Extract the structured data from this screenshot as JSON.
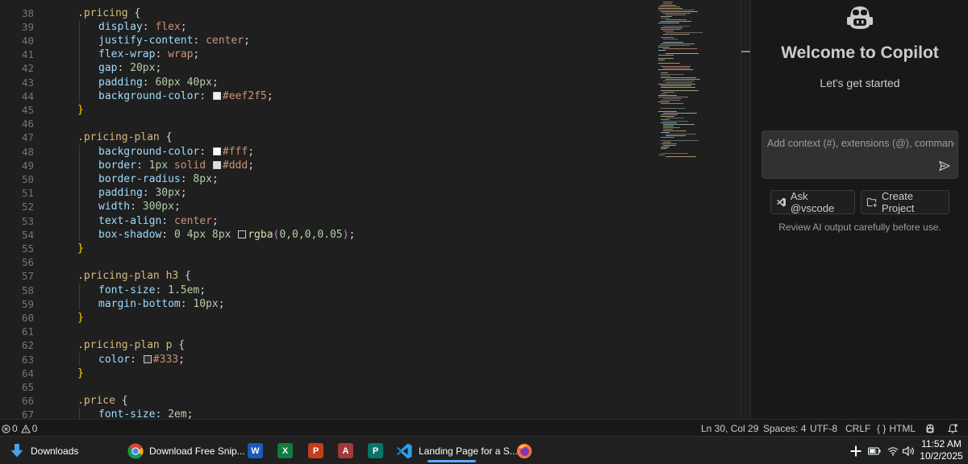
{
  "editor": {
    "line_numbers": [
      "38",
      "39",
      "40",
      "41",
      "42",
      "43",
      "44",
      "45",
      "46",
      "47",
      "48",
      "49",
      "50",
      "51",
      "52",
      "53",
      "54",
      "55",
      "56",
      "57",
      "58",
      "59",
      "60",
      "61",
      "62",
      "63",
      "64",
      "65",
      "66",
      "67"
    ],
    "lines": [
      [
        {
          "t": ".pricing",
          "c": "#d7ba7d"
        },
        {
          "t": " {",
          "c": "#d4d4d4"
        }
      ],
      [
        {
          "t": "display",
          "c": "#9cdcfe"
        },
        {
          "t": ": ",
          "c": "#d4d4d4"
        },
        {
          "t": "flex",
          "c": "#ce9178"
        },
        {
          "t": ";",
          "c": "#d4d4d4"
        }
      ],
      [
        {
          "t": "justify-content",
          "c": "#9cdcfe"
        },
        {
          "t": ": ",
          "c": "#d4d4d4"
        },
        {
          "t": "center",
          "c": "#ce9178"
        },
        {
          "t": ";",
          "c": "#d4d4d4"
        }
      ],
      [
        {
          "t": "flex-wrap",
          "c": "#9cdcfe"
        },
        {
          "t": ": ",
          "c": "#d4d4d4"
        },
        {
          "t": "wrap",
          "c": "#ce9178"
        },
        {
          "t": ";",
          "c": "#d4d4d4"
        }
      ],
      [
        {
          "t": "gap",
          "c": "#9cdcfe"
        },
        {
          "t": ": ",
          "c": "#d4d4d4"
        },
        {
          "t": "20px",
          "c": "#b5cea8"
        },
        {
          "t": ";",
          "c": "#d4d4d4"
        }
      ],
      [
        {
          "t": "padding",
          "c": "#9cdcfe"
        },
        {
          "t": ": ",
          "c": "#d4d4d4"
        },
        {
          "t": "60px 40px",
          "c": "#b5cea8"
        },
        {
          "t": ";",
          "c": "#d4d4d4"
        }
      ],
      [
        {
          "t": "background-color",
          "c": "#9cdcfe"
        },
        {
          "t": ": ",
          "c": "#d4d4d4"
        },
        {
          "sw": "#eef2f5"
        },
        {
          "t": "#eef2f5",
          "c": "#ce9178"
        },
        {
          "t": ";",
          "c": "#d4d4d4"
        }
      ],
      [
        {
          "t": "}",
          "c": "#ffd700"
        }
      ],
      [],
      [
        {
          "t": ".pricing-plan",
          "c": "#d7ba7d"
        },
        {
          "t": " {",
          "c": "#d4d4d4"
        }
      ],
      [
        {
          "t": "background-color",
          "c": "#9cdcfe"
        },
        {
          "t": ": ",
          "c": "#d4d4d4"
        },
        {
          "sw": "#ffffff"
        },
        {
          "t": "#fff",
          "c": "#ce9178"
        },
        {
          "t": ";",
          "c": "#d4d4d4"
        }
      ],
      [
        {
          "t": "border",
          "c": "#9cdcfe"
        },
        {
          "t": ": ",
          "c": "#d4d4d4"
        },
        {
          "t": "1px",
          "c": "#b5cea8"
        },
        {
          "t": " solid ",
          "c": "#ce9178"
        },
        {
          "sw": "#dddddd"
        },
        {
          "t": "#ddd",
          "c": "#ce9178"
        },
        {
          "t": ";",
          "c": "#d4d4d4"
        }
      ],
      [
        {
          "t": "border-radius",
          "c": "#9cdcfe"
        },
        {
          "t": ": ",
          "c": "#d4d4d4"
        },
        {
          "t": "8px",
          "c": "#b5cea8"
        },
        {
          "t": ";",
          "c": "#d4d4d4"
        }
      ],
      [
        {
          "t": "padding",
          "c": "#9cdcfe"
        },
        {
          "t": ": ",
          "c": "#d4d4d4"
        },
        {
          "t": "30px",
          "c": "#b5cea8"
        },
        {
          "t": ";",
          "c": "#d4d4d4"
        }
      ],
      [
        {
          "t": "width",
          "c": "#9cdcfe"
        },
        {
          "t": ": ",
          "c": "#d4d4d4"
        },
        {
          "t": "300px",
          "c": "#b5cea8"
        },
        {
          "t": ";",
          "c": "#d4d4d4"
        }
      ],
      [
        {
          "t": "text-align",
          "c": "#9cdcfe"
        },
        {
          "t": ": ",
          "c": "#d4d4d4"
        },
        {
          "t": "center",
          "c": "#ce9178"
        },
        {
          "t": ";",
          "c": "#d4d4d4"
        }
      ],
      [
        {
          "t": "box-shadow",
          "c": "#9cdcfe"
        },
        {
          "t": ": ",
          "c": "#d4d4d4"
        },
        {
          "t": "0 4px 8px ",
          "c": "#b5cea8"
        },
        {
          "sw": "transparent"
        },
        {
          "t": "rgba",
          "c": "#dcdcaa"
        },
        {
          "t": "(",
          "c": "#da70d6"
        },
        {
          "t": "0,0,0,0.05",
          "c": "#b5cea8"
        },
        {
          "t": ")",
          "c": "#da70d6"
        },
        {
          "t": ";",
          "c": "#d4d4d4"
        }
      ],
      [
        {
          "t": "}",
          "c": "#ffd700"
        }
      ],
      [],
      [
        {
          "t": ".pricing-plan h3",
          "c": "#d7ba7d"
        },
        {
          "t": " {",
          "c": "#d4d4d4"
        }
      ],
      [
        {
          "t": "font-size",
          "c": "#9cdcfe"
        },
        {
          "t": ": ",
          "c": "#d4d4d4"
        },
        {
          "t": "1.5em",
          "c": "#b5cea8"
        },
        {
          "t": ";",
          "c": "#d4d4d4"
        }
      ],
      [
        {
          "t": "margin-bottom",
          "c": "#9cdcfe"
        },
        {
          "t": ": ",
          "c": "#d4d4d4"
        },
        {
          "t": "10px",
          "c": "#b5cea8"
        },
        {
          "t": ";",
          "c": "#d4d4d4"
        }
      ],
      [
        {
          "t": "}",
          "c": "#ffd700"
        }
      ],
      [],
      [
        {
          "t": ".pricing-plan p",
          "c": "#d7ba7d"
        },
        {
          "t": " {",
          "c": "#d4d4d4"
        }
      ],
      [
        {
          "t": "color",
          "c": "#9cdcfe"
        },
        {
          "t": ": ",
          "c": "#d4d4d4"
        },
        {
          "sw": "#333333"
        },
        {
          "t": "#333",
          "c": "#ce9178"
        },
        {
          "t": ";",
          "c": "#d4d4d4"
        }
      ],
      [
        {
          "t": "}",
          "c": "#ffd700"
        }
      ],
      [],
      [
        {
          "t": ".price",
          "c": "#d7ba7d"
        },
        {
          "t": " {",
          "c": "#d4d4d4"
        }
      ],
      [
        {
          "t": "font-size",
          "c": "#9cdcfe"
        },
        {
          "t": ": ",
          "c": "#d4d4d4"
        },
        {
          "t": "2em",
          "c": "#b5cea8"
        },
        {
          "t": ";",
          "c": "#d4d4d4"
        }
      ]
    ],
    "indent_levels": [
      1,
      2,
      2,
      2,
      2,
      2,
      2,
      1,
      0,
      1,
      2,
      2,
      2,
      2,
      2,
      2,
      2,
      1,
      0,
      1,
      2,
      2,
      1,
      0,
      1,
      2,
      1,
      0,
      1,
      2
    ]
  },
  "copilot": {
    "title": "Welcome to Copilot",
    "subtitle": "Let's get started",
    "input_placeholder": "Add context (#), extensions (@), commands",
    "ask_label": "Ask @vscode",
    "create_label": "Create Project",
    "review_note": "Review AI output carefully before use."
  },
  "statusbar": {
    "errors": "0",
    "warnings": "0",
    "position": "Ln 30, Col 29",
    "spaces": "Spaces: 4",
    "encoding": "UTF-8",
    "eol": "CRLF",
    "language": "HTML",
    "language_prefix": "{ }"
  },
  "taskbar": {
    "downloads": "Downloads",
    "chrome": "Download Free Snip...",
    "vscode": "Landing Page for a S...",
    "time": "11:52 AM",
    "date": "10/2/2025",
    "colors": {
      "accent": "#5cb0ff",
      "word": "#185abd",
      "excel": "#107c41",
      "powerpoint": "#c43e1c",
      "access": "#a4373a",
      "publisher": "#077568"
    }
  }
}
